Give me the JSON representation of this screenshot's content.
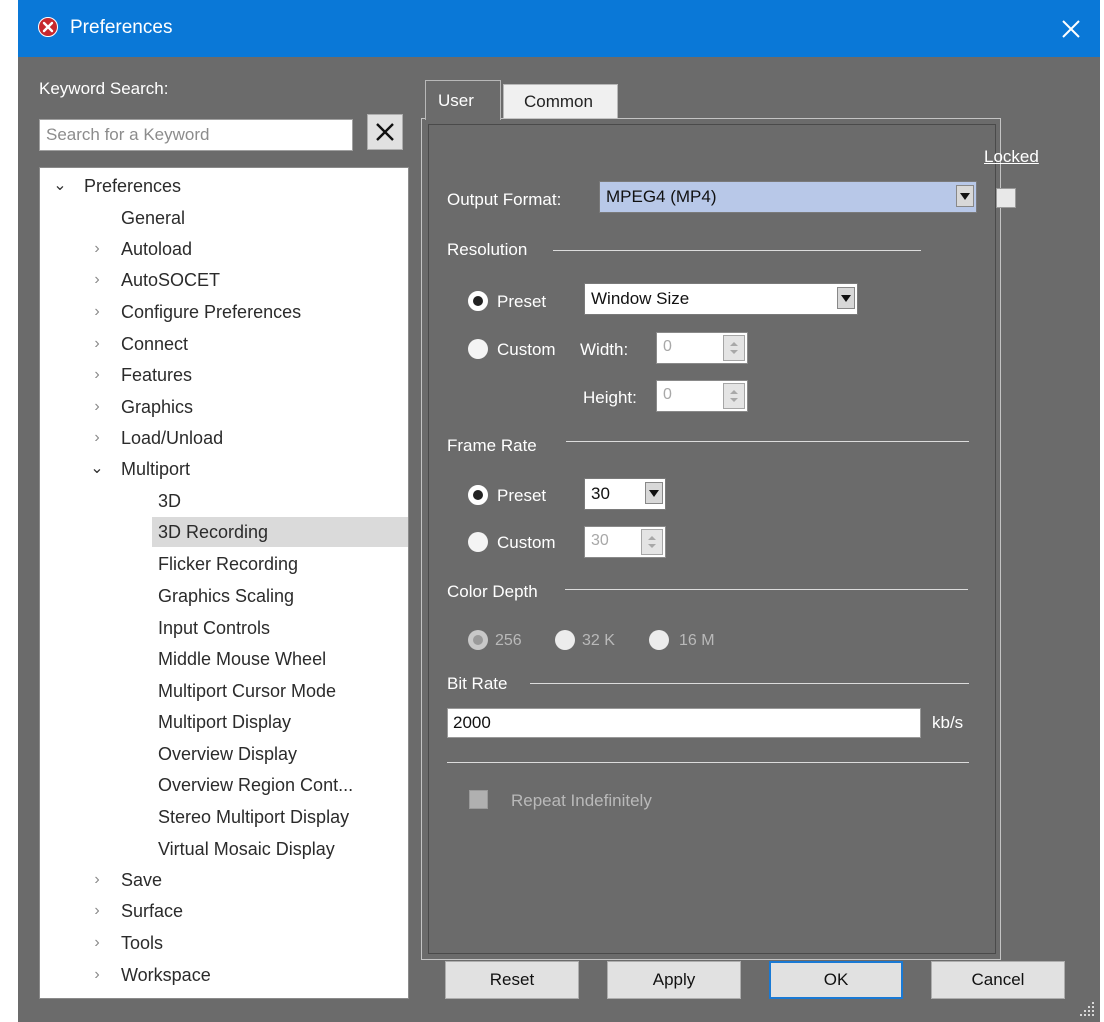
{
  "window": {
    "title": "Preferences"
  },
  "keyword_search": {
    "label": "Keyword Search:",
    "placeholder": "Search for a Keyword"
  },
  "tree": {
    "root": "Preferences",
    "items": [
      "General",
      "Autoload",
      "AutoSOCET",
      "Configure Preferences",
      "Connect",
      "Features",
      "Graphics",
      "Load/Unload"
    ],
    "multiport": {
      "label": "Multiport",
      "children": [
        "3D",
        "3D Recording",
        "Flicker Recording",
        "Graphics Scaling",
        "Input Controls",
        "Middle Mouse Wheel",
        "Multiport Cursor Mode",
        "Multiport Display",
        "Overview Display",
        "Overview Region Cont...",
        "Stereo Multiport Display",
        "Virtual Mosaic Display"
      ],
      "selected": "3D Recording"
    },
    "items_after": [
      "Save",
      "Surface",
      "Tools",
      "Workspace"
    ]
  },
  "tabs": {
    "user": "User",
    "common": "Common"
  },
  "locked": {
    "label": "Locked"
  },
  "output_format": {
    "label": "Output Format:",
    "value": "MPEG4 (MP4)"
  },
  "resolution": {
    "label": "Resolution",
    "preset_label": "Preset",
    "preset_value": "Window Size",
    "custom_label": "Custom",
    "width_label": "Width:",
    "width_value": "0",
    "height_label": "Height:",
    "height_value": "0",
    "selected": "Preset"
  },
  "frame_rate": {
    "label": "Frame Rate",
    "preset_label": "Preset",
    "preset_value": "30",
    "custom_label": "Custom",
    "custom_value": "30",
    "selected": "Preset"
  },
  "color_depth": {
    "label": "Color Depth",
    "options": [
      "256",
      "32 K",
      "16 M"
    ],
    "selected": "256"
  },
  "bit_rate": {
    "label": "Bit Rate",
    "value": "2000",
    "unit": "kb/s"
  },
  "repeat": {
    "label": "Repeat Indefinitely"
  },
  "buttons": {
    "reset": "Reset",
    "apply": "Apply",
    "ok": "OK",
    "cancel": "Cancel"
  },
  "colors": {
    "titlebar": "#0a78d7",
    "panel": "#6b6b6b",
    "selection": "#dadada",
    "ok_border": "#1979d4"
  }
}
